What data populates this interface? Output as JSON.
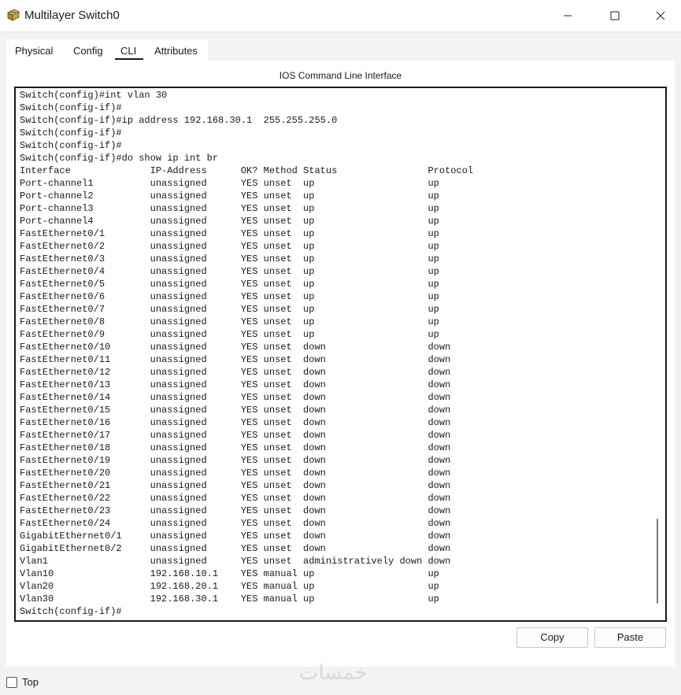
{
  "window": {
    "title": "Multilayer Switch0",
    "app_icon": "packet-tracer-switch-icon",
    "controls": [
      "minimize-icon",
      "maximize-icon",
      "close-icon"
    ]
  },
  "tabs": [
    {
      "label": "Physical",
      "active": false
    },
    {
      "label": "Config",
      "active": false
    },
    {
      "label": "CLI",
      "active": true
    },
    {
      "label": "Attributes",
      "active": false
    }
  ],
  "panel": {
    "title": "IOS Command Line Interface"
  },
  "terminal": {
    "lines": [
      "Switch(config)#int vlan 30",
      "Switch(config-if)#",
      "Switch(config-if)#ip address 192.168.30.1  255.255.255.0",
      "Switch(config-if)#",
      "Switch(config-if)#",
      "Switch(config-if)#do show ip int br",
      "Interface              IP-Address      OK? Method Status                Protocol",
      "Port-channel1          unassigned      YES unset  up                    up",
      "Port-channel2          unassigned      YES unset  up                    up",
      "Port-channel3          unassigned      YES unset  up                    up",
      "Port-channel4          unassigned      YES unset  up                    up",
      "FastEthernet0/1        unassigned      YES unset  up                    up",
      "FastEthernet0/2        unassigned      YES unset  up                    up",
      "FastEthernet0/3        unassigned      YES unset  up                    up",
      "FastEthernet0/4        unassigned      YES unset  up                    up",
      "FastEthernet0/5        unassigned      YES unset  up                    up",
      "FastEthernet0/6        unassigned      YES unset  up                    up",
      "FastEthernet0/7        unassigned      YES unset  up                    up",
      "FastEthernet0/8        unassigned      YES unset  up                    up",
      "FastEthernet0/9        unassigned      YES unset  up                    up",
      "FastEthernet0/10       unassigned      YES unset  down                  down",
      "FastEthernet0/11       unassigned      YES unset  down                  down",
      "FastEthernet0/12       unassigned      YES unset  down                  down",
      "FastEthernet0/13       unassigned      YES unset  down                  down",
      "FastEthernet0/14       unassigned      YES unset  down                  down",
      "FastEthernet0/15       unassigned      YES unset  down                  down",
      "FastEthernet0/16       unassigned      YES unset  down                  down",
      "FastEthernet0/17       unassigned      YES unset  down                  down",
      "FastEthernet0/18       unassigned      YES unset  down                  down",
      "FastEthernet0/19       unassigned      YES unset  down                  down",
      "FastEthernet0/20       unassigned      YES unset  down                  down",
      "FastEthernet0/21       unassigned      YES unset  down                  down",
      "FastEthernet0/22       unassigned      YES unset  down                  down",
      "FastEthernet0/23       unassigned      YES unset  down                  down",
      "FastEthernet0/24       unassigned      YES unset  down                  down",
      "GigabitEthernet0/1     unassigned      YES unset  down                  down",
      "GigabitEthernet0/2     unassigned      YES unset  down                  down",
      "Vlan1                  unassigned      YES unset  administratively down down",
      "Vlan10                 192.168.10.1    YES manual up                    up",
      "Vlan20                 192.168.20.1    YES manual up                    up",
      "Vlan30                 192.168.30.1    YES manual up                    up",
      "Switch(config-if)#"
    ]
  },
  "buttons": {
    "copy": "Copy",
    "paste": "Paste"
  },
  "footer": {
    "top_label": "Top",
    "top_checked": false
  },
  "watermark": "خمسات",
  "colors": {
    "background": "#f3f3f3",
    "panel": "#ffffff",
    "text": "#1a1a1a",
    "terminal_border": "#1a1a1a"
  }
}
